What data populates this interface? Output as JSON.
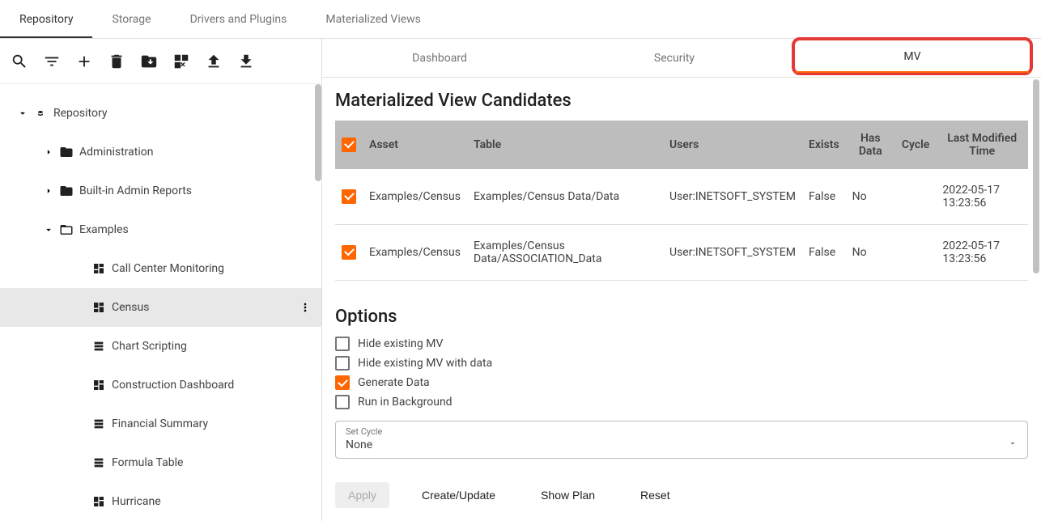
{
  "top_tabs": {
    "repository": "Repository",
    "storage": "Storage",
    "drivers": "Drivers and Plugins",
    "mv": "Materialized Views"
  },
  "tree": {
    "root": "Repository",
    "administration": "Administration",
    "builtin": "Built-in Admin Reports",
    "examples": "Examples",
    "items": {
      "call_center": "Call Center Monitoring",
      "census": "Census",
      "chart_scripting": "Chart Scripting",
      "construction": "Construction Dashboard",
      "financial": "Financial Summary",
      "formula": "Formula Table",
      "hurricane": "Hurricane"
    }
  },
  "sub_tabs": {
    "dashboard": "Dashboard",
    "security": "Security",
    "mv": "MV"
  },
  "candidates": {
    "title": "Materialized View Candidates",
    "headers": {
      "asset": "Asset",
      "table": "Table",
      "users": "Users",
      "exists": "Exists",
      "has_data": "Has Data",
      "cycle": "Cycle",
      "modified": "Last Modified Time"
    },
    "rows": [
      {
        "asset": "Examples/Census",
        "table": "Examples/Census Data/Data",
        "users": "User:INETSOFT_SYSTEM",
        "exists": "False",
        "has_data": "No",
        "cycle": "",
        "modified": "2022-05-17 13:23:56"
      },
      {
        "asset": "Examples/Census",
        "table": "Examples/Census Data/ASSOCIATION_Data",
        "users": "User:INETSOFT_SYSTEM",
        "exists": "False",
        "has_data": "No",
        "cycle": "",
        "modified": "2022-05-17 13:23:56"
      }
    ]
  },
  "options": {
    "title": "Options",
    "hide_existing": "Hide existing MV",
    "hide_existing_data": "Hide existing MV with data",
    "generate": "Generate Data",
    "background": "Run in Background",
    "cycle_label": "Set Cycle",
    "cycle_value": "None"
  },
  "buttons": {
    "apply": "Apply",
    "create": "Create/Update",
    "plan": "Show Plan",
    "reset": "Reset"
  }
}
